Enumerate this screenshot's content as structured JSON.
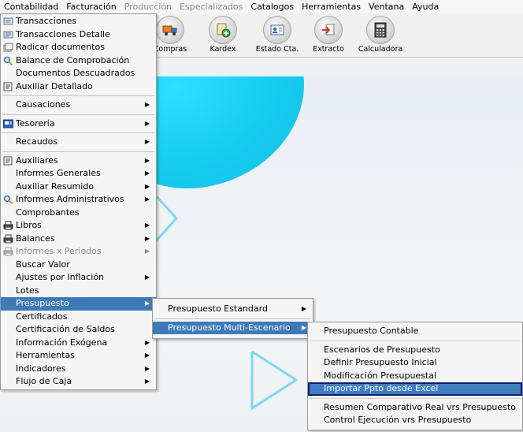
{
  "menubar": {
    "items": [
      {
        "label": "Contabilidad",
        "disabled": false
      },
      {
        "label": "Facturación",
        "disabled": false
      },
      {
        "label": "Producción",
        "disabled": true
      },
      {
        "label": "Especializados",
        "disabled": true
      },
      {
        "label": "Catalogos",
        "disabled": false
      },
      {
        "label": "Herramientas",
        "disabled": false
      },
      {
        "label": "Ventana",
        "disabled": false
      },
      {
        "label": "Ayuda",
        "disabled": false
      }
    ]
  },
  "toolbar": {
    "buttons": [
      {
        "label": "Compras",
        "icon": "truck-icon"
      },
      {
        "label": "Kardex",
        "icon": "kardex-add-icon"
      },
      {
        "label": "Estado Cta.",
        "icon": "id-card-icon"
      },
      {
        "label": "Extracto",
        "icon": "extract-arrow-icon"
      },
      {
        "label": "Calculadora",
        "icon": "calculator-icon"
      }
    ]
  },
  "menu1": {
    "items": [
      {
        "label": "Transacciones",
        "icon": "transactions-icon",
        "arrow": false
      },
      {
        "label": "Transacciones Detalle",
        "icon": "transactions-detail-icon",
        "arrow": false
      },
      {
        "label": "Radicar documentos",
        "icon": "file-docs-icon",
        "arrow": false
      },
      {
        "label": "Balance de Comprobación",
        "icon": "magnifier-icon",
        "arrow": false
      },
      {
        "label": "Documentos Descuadrados",
        "icon": null,
        "arrow": false
      },
      {
        "label": "Auxiliar Detallado",
        "icon": "ledger-icon",
        "arrow": false
      },
      {
        "sep": true
      },
      {
        "label": "Causaciones",
        "icon": null,
        "arrow": true
      },
      {
        "sep": true
      },
      {
        "label": "Tesorería",
        "icon": "treasury-icon",
        "arrow": true
      },
      {
        "sep": true
      },
      {
        "label": "Recaudos",
        "icon": null,
        "arrow": true
      },
      {
        "sep": true
      },
      {
        "label": "Auxiliares",
        "icon": "ledger-icon",
        "arrow": true
      },
      {
        "label": "Informes Generales",
        "icon": null,
        "arrow": true
      },
      {
        "label": "Auxiliar Resumido",
        "icon": null,
        "arrow": true
      },
      {
        "label": "Informes Administrativos",
        "icon": "magnifier-icon",
        "arrow": true
      },
      {
        "label": "Comprobantes",
        "icon": null,
        "arrow": false
      },
      {
        "label": "Libros",
        "icon": "printer-icon",
        "arrow": true
      },
      {
        "label": "Balances",
        "icon": "printer-icon",
        "arrow": true
      },
      {
        "label": "Informes x Periodos",
        "icon": "printer-icon",
        "arrow": true,
        "disabled": true
      },
      {
        "label": "Buscar Valor",
        "icon": null,
        "arrow": false
      },
      {
        "label": "Ajustes por Inflación",
        "icon": null,
        "arrow": true
      },
      {
        "label": "Lotes",
        "icon": null,
        "arrow": false
      },
      {
        "label": "Presupuesto",
        "icon": null,
        "arrow": true,
        "selected": true
      },
      {
        "label": "Certificados",
        "icon": null,
        "arrow": false
      },
      {
        "label": "Certificación de Saldos",
        "icon": null,
        "arrow": false
      },
      {
        "label": "Información Exógena",
        "icon": null,
        "arrow": true
      },
      {
        "label": "Herramientas",
        "icon": null,
        "arrow": true
      },
      {
        "label": "Indicadores",
        "icon": null,
        "arrow": true
      },
      {
        "label": "Flujo de Caja",
        "icon": null,
        "arrow": true
      }
    ]
  },
  "menu2": {
    "items": [
      {
        "label": "Presupuesto  Estandard",
        "arrow": true
      },
      {
        "sep": true
      },
      {
        "label": "Presupuesto Multi-Escenario",
        "arrow": true,
        "selected": true
      }
    ]
  },
  "menu3": {
    "items": [
      {
        "label": "Presupuesto Contable"
      },
      {
        "sep": true
      },
      {
        "label": "Escenarios de Presupuesto"
      },
      {
        "label": "Definir Presupuesto Inicial"
      },
      {
        "label": "Modificación Presupuestal"
      },
      {
        "label": "Importar Ppto desde Excel",
        "focused": true
      },
      {
        "sep": true
      },
      {
        "label": "Resumen Comparativo  Real vrs Presupuesto"
      },
      {
        "label": "Control Ejecución vrs Presupuesto"
      }
    ]
  },
  "colors": {
    "selection": "#3e7ab8",
    "focus_border": "#0c1e6e",
    "accent_blob": "#19cdef"
  }
}
